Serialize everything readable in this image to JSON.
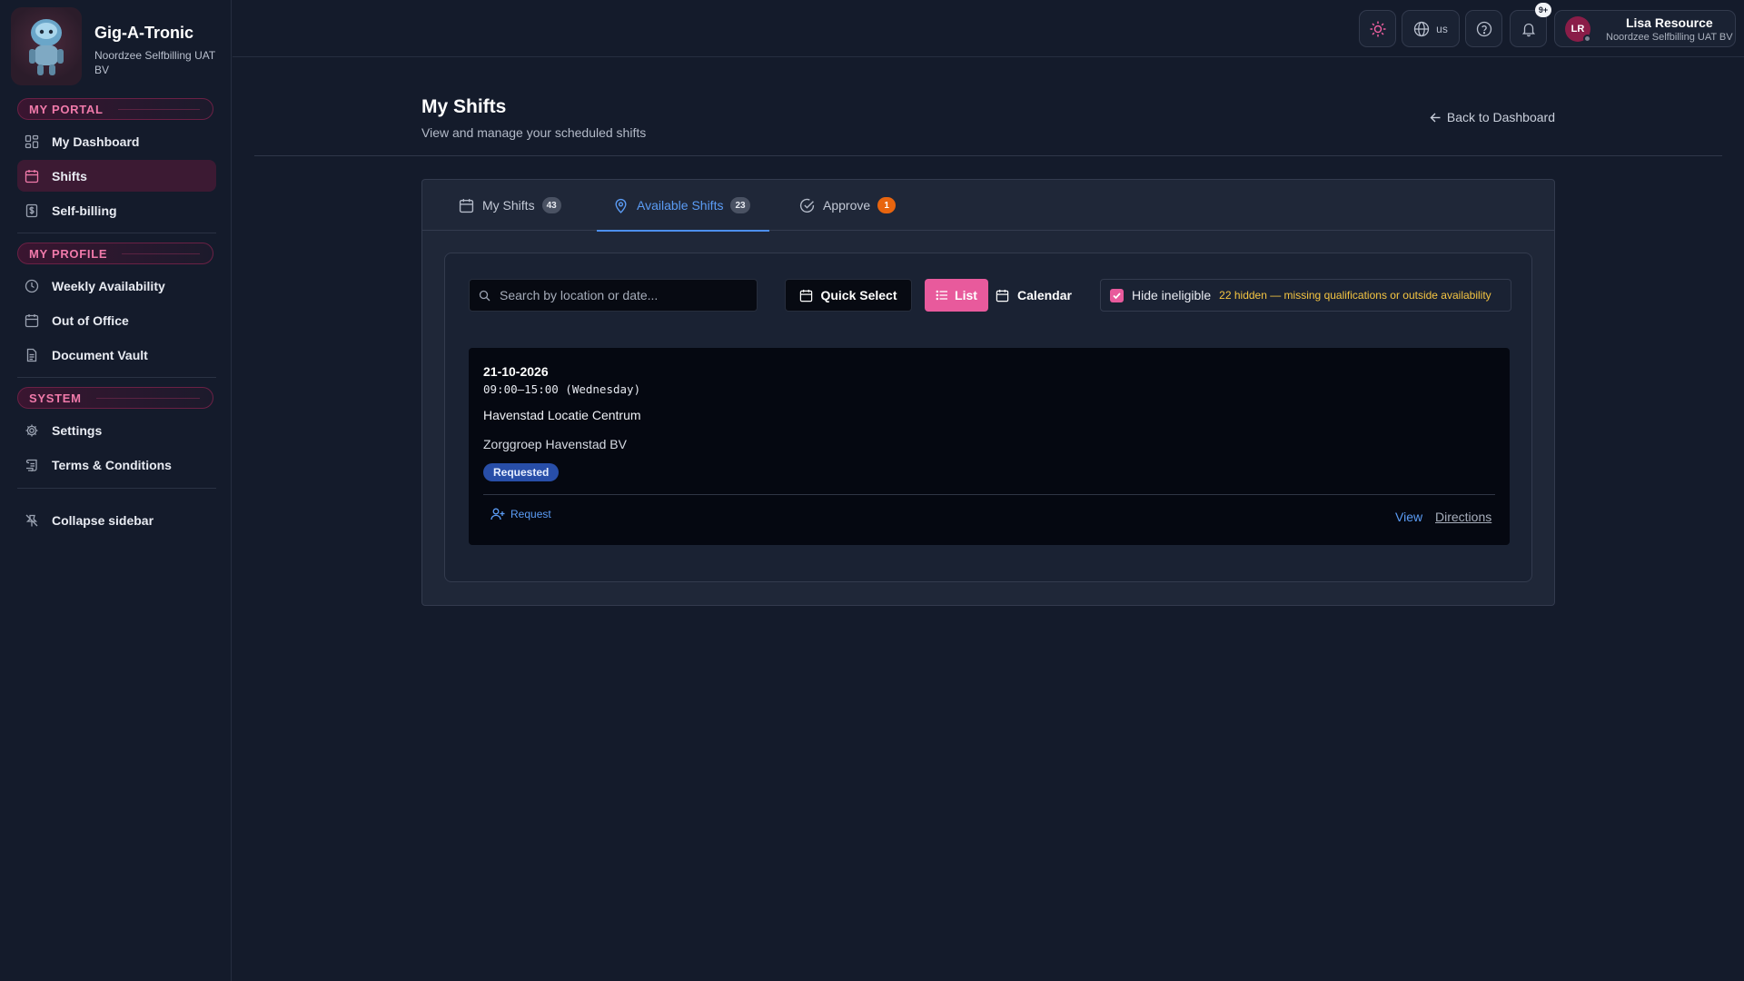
{
  "brand": {
    "name": "Gig-A-Tronic",
    "company": "Noordzee Selfbilling UAT BV"
  },
  "sidebar": {
    "sections": [
      {
        "label": "MY PORTAL"
      },
      {
        "label": "MY PROFILE"
      },
      {
        "label": "SYSTEM"
      }
    ],
    "items": [
      {
        "label": "My Dashboard",
        "icon": "dashboard-grid-icon"
      },
      {
        "label": "Shifts",
        "icon": "calendar-icon",
        "active": true
      },
      {
        "label": "Self-billing",
        "icon": "dollar-document-icon"
      },
      {
        "label": "Weekly Availability",
        "icon": "clock-icon"
      },
      {
        "label": "Out of Office",
        "icon": "calendar-icon"
      },
      {
        "label": "Document Vault",
        "icon": "document-icon"
      },
      {
        "label": "Settings",
        "icon": "gear-icon"
      },
      {
        "label": "Terms & Conditions",
        "icon": "scroll-icon"
      }
    ],
    "collapse_label": "Collapse sidebar"
  },
  "topbar": {
    "language": "us",
    "notifications_badge": "9+",
    "user": {
      "initials": "LR",
      "name": "Lisa Resource",
      "company": "Noordzee Selfbilling UAT BV"
    }
  },
  "page": {
    "title": "My Shifts",
    "subtitle": "View and manage your scheduled shifts",
    "back_label": "Back to Dashboard"
  },
  "tabs": [
    {
      "label": "My Shifts",
      "count": "43",
      "icon": "calendar-icon"
    },
    {
      "label": "Available Shifts",
      "count": "23",
      "icon": "map-pin-icon",
      "active": true
    },
    {
      "label": "Approve",
      "count": "1",
      "icon": "check-circle-icon"
    }
  ],
  "toolbar": {
    "search_placeholder": "Search by location or date...",
    "quick_select_label": "Quick Select",
    "list_label": "List",
    "calendar_label": "Calendar",
    "hide_ineligible_label": "Hide ineligible",
    "hide_ineligible_checked": true,
    "hidden_note": "22 hidden — missing qualifications or outside availability"
  },
  "shifts": [
    {
      "date": "21-10-2026",
      "time": "09:00–15:00 (Wednesday)",
      "location": "Havenstad Locatie Centrum",
      "organization": "Zorggroep Havenstad BV",
      "status": "Requested",
      "request_label": "Request",
      "view_label": "View",
      "directions_label": "Directions"
    }
  ],
  "colors": {
    "accent_pink": "#e85a9c",
    "accent_blue": "#5b9cf5",
    "warning": "#f5c542",
    "badge_orange": "#e8650f",
    "status_blue": "#284ea8"
  }
}
